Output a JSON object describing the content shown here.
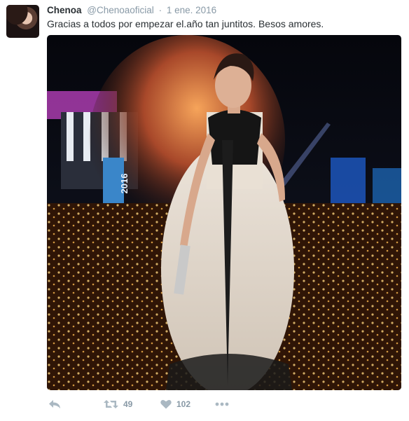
{
  "tweet": {
    "author_name": "Chenoa",
    "author_handle": "@Chenoaoficial",
    "separator": "·",
    "timestamp": "1 ene. 2016",
    "text": "Gracias a todos por empezar el.año tan juntitos. Besos amores.",
    "photo_sign_text": "2016"
  },
  "actions": {
    "reply_icon": "reply-icon",
    "retweet_icon": "retweet-icon",
    "retweet_count": "49",
    "like_icon": "heart-icon",
    "like_count": "102",
    "more_icon": "more-icon"
  },
  "colors": {
    "text": "#292f33",
    "muted": "#8899a6",
    "icon": "#aab8c2"
  }
}
